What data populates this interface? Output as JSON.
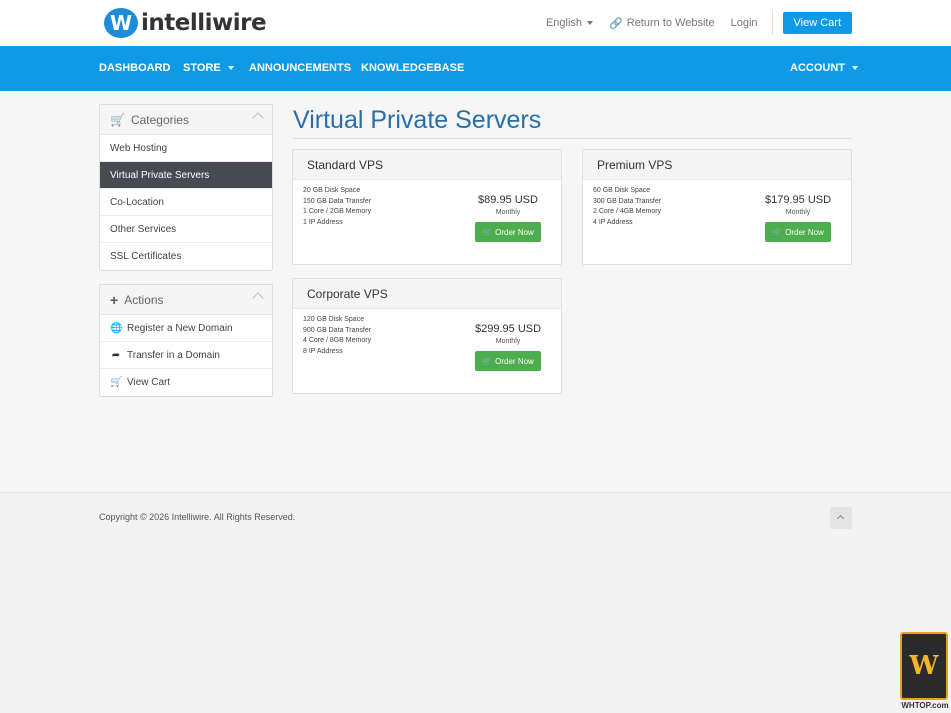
{
  "brand": {
    "logo_mark": "W",
    "logo_text": "intelliwire",
    "accent": "#0e9ae7",
    "title_color": "#2a6ea8",
    "order_green": "#4cae4c"
  },
  "top": {
    "language": "English",
    "return": "Return to Website",
    "login": "Login",
    "view_cart": "View Cart"
  },
  "nav": {
    "dashboard": "DASHBOARD",
    "store": "STORE",
    "announcements": "ANNOUNCEMENTS",
    "knowledgebase": "KNOWLEDGEBASE",
    "account": "ACCOUNT"
  },
  "sidebar": {
    "categories": {
      "title": "Categories",
      "icon": "cart-icon",
      "items": [
        "Web Hosting",
        "Virtual Private Servers",
        "Co-Location",
        "Other Services",
        "SSL Certificates"
      ],
      "active_index": 1
    },
    "actions": {
      "title": "Actions",
      "icon": "plus-icon",
      "items": [
        {
          "label": "Register a New Domain",
          "icon": "globe-icon"
        },
        {
          "label": "Transfer in a Domain",
          "icon": "share-arrow-icon"
        },
        {
          "label": "View Cart",
          "icon": "cart-icon"
        }
      ]
    }
  },
  "main": {
    "title": "Virtual Private Servers",
    "products": [
      {
        "name": "Standard VPS",
        "features": [
          "20 GB Disk Space",
          "150 GB Data Transfer",
          "1 Core / 2GB Memory",
          "1 IP Address"
        ],
        "price": "$89.95 USD",
        "cycle": "Monthly",
        "order": "Order Now"
      },
      {
        "name": "Premium VPS",
        "features": [
          "60 GB Disk Space",
          "300 GB Data Transfer",
          "2 Core / 4GB Memory",
          "4 IP Address"
        ],
        "price": "$179.95 USD",
        "cycle": "Monthly",
        "order": "Order Now"
      },
      {
        "name": "Corporate VPS",
        "features": [
          "120 GB Disk Space",
          "900 GB Data Transfer",
          "4 Core / 8GB Memory",
          "8 IP Address"
        ],
        "price": "$299.95 USD",
        "cycle": "Monthly",
        "order": "Order Now"
      }
    ]
  },
  "footer": {
    "copyright": "Copyright © 2026 Intelliwire. All Rights Reserved."
  },
  "watermark": {
    "mark": "W",
    "text": "WHTOP.com"
  }
}
